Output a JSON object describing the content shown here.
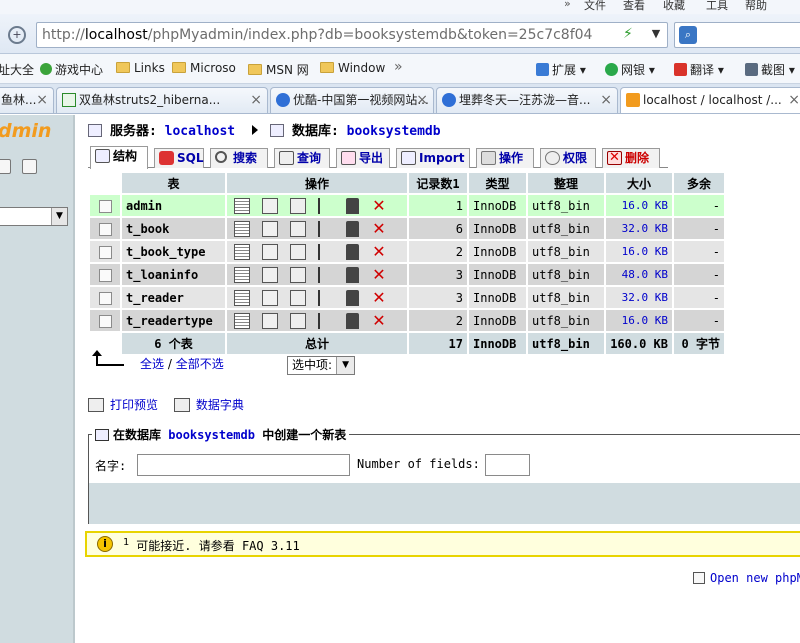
{
  "browser": {
    "menu": [
      "文件",
      "查看",
      "收藏",
      "工具",
      "帮助"
    ],
    "url_scheme": "http://",
    "url_host": "localhost",
    "url_rest": "/phpMyadmin/index.php?db=booksystemdb&token=25c7c8f04",
    "favorites": [
      "址大全",
      "游戏中心",
      "Links",
      "Microso",
      "MSN 网",
      "Window"
    ],
    "toolbar": [
      "扩展",
      "网银",
      "翻译",
      "截图"
    ],
    "tabs": [
      "鱼林...",
      "双鱼林struts2_hiberna...",
      "优酷-中国第一视频网站...",
      "埋葬冬天—汪苏泷—音...",
      "localhost / localhost /..."
    ]
  },
  "pma": {
    "logo": "dmin",
    "server_label": "服务器:",
    "server_value": "localhost",
    "db_label": "数据库:",
    "db_value": "booksystemdb",
    "tabs": [
      "结构",
      "SQL",
      "搜索",
      "查询",
      "导出",
      "Import",
      "操作",
      "权限",
      "删除"
    ],
    "columns": {
      "table": "表",
      "ops": "操作",
      "rows": "记录数1",
      "type": "类型",
      "collation": "整理",
      "size": "大小",
      "overhead": "多余"
    },
    "rows": [
      {
        "name": "admin",
        "rows": "1",
        "type": "InnoDB",
        "collation": "utf8_bin",
        "size": "16.0 KB",
        "overhead": "-"
      },
      {
        "name": "t_book",
        "rows": "6",
        "type": "InnoDB",
        "collation": "utf8_bin",
        "size": "32.0 KB",
        "overhead": "-"
      },
      {
        "name": "t_book_type",
        "rows": "2",
        "type": "InnoDB",
        "collation": "utf8_bin",
        "size": "16.0 KB",
        "overhead": "-"
      },
      {
        "name": "t_loaninfo",
        "rows": "3",
        "type": "InnoDB",
        "collation": "utf8_bin",
        "size": "48.0 KB",
        "overhead": "-"
      },
      {
        "name": "t_reader",
        "rows": "3",
        "type": "InnoDB",
        "collation": "utf8_bin",
        "size": "32.0 KB",
        "overhead": "-"
      },
      {
        "name": "t_readertype",
        "rows": "2",
        "type": "InnoDB",
        "collation": "utf8_bin",
        "size": "16.0 KB",
        "overhead": "-"
      }
    ],
    "totals": {
      "tables": "6 个表",
      "label": "总计",
      "rows": "17",
      "type": "InnoDB",
      "collation": "utf8_bin",
      "size": "160.0 KB",
      "overhead": "0 字节"
    },
    "check_all": "全选",
    "separator": "/",
    "uncheck_all": "全部不选",
    "with_selected": "选中项:",
    "print_view": "打印预览",
    "data_dictionary": "数据字典",
    "create_prefix": "在数据库",
    "create_db": "booksystemdb",
    "create_suffix": "中创建一个新表",
    "name_label": "名字:",
    "fields_label": "Number of fields:",
    "notice_sup": "1",
    "notice_text": "可能接近. 请参看 FAQ 3.11",
    "open_new": "Open new phpM"
  }
}
